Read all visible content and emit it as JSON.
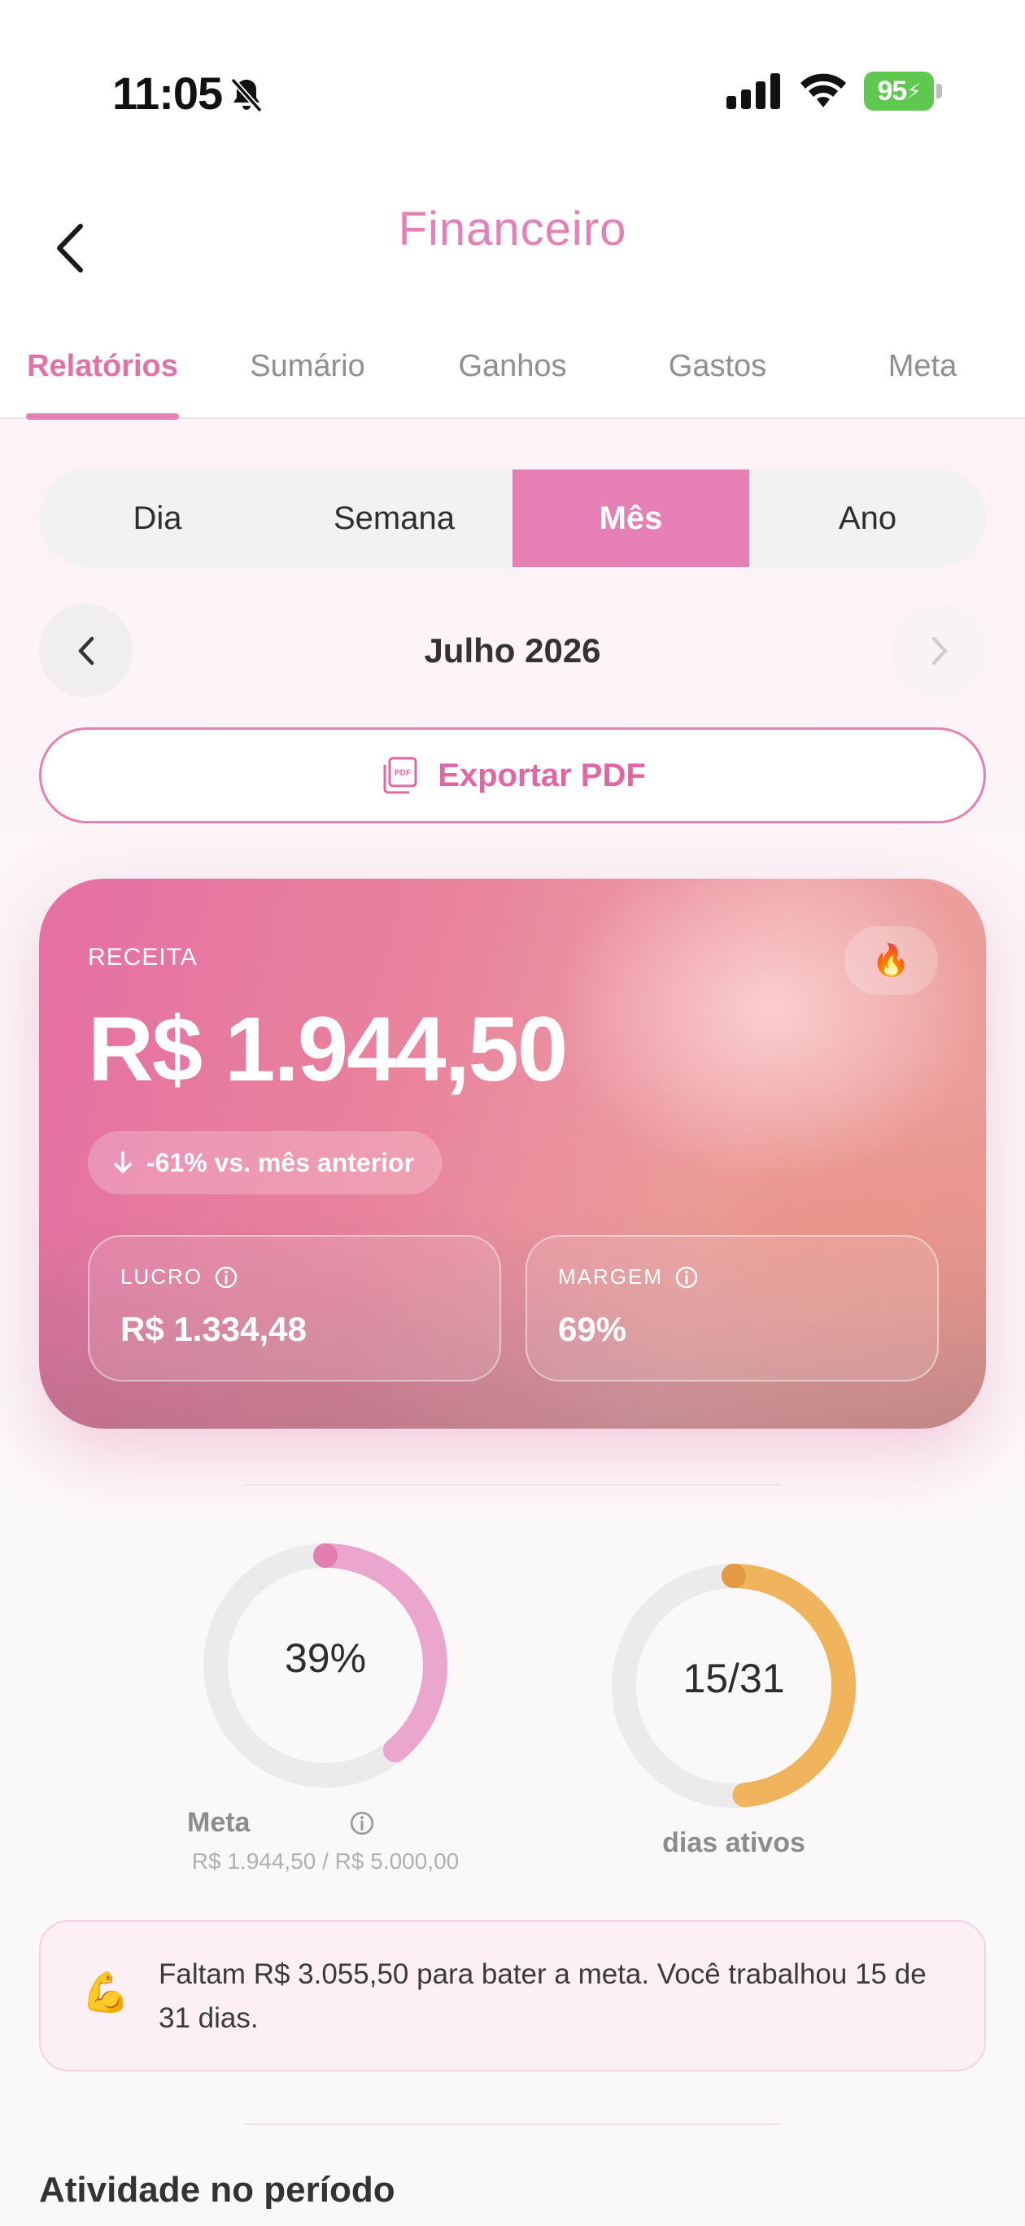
{
  "status": {
    "time": "11:05",
    "battery": "95"
  },
  "header": {
    "title": "Financeiro",
    "tabs": [
      {
        "label": "Relatórios",
        "active": true
      },
      {
        "label": "Sumário",
        "active": false
      },
      {
        "label": "Ganhos",
        "active": false
      },
      {
        "label": "Gastos",
        "active": false
      },
      {
        "label": "Meta",
        "active": false
      }
    ]
  },
  "period": {
    "options": [
      {
        "label": "Dia",
        "active": false
      },
      {
        "label": "Semana",
        "active": false
      },
      {
        "label": "Mês",
        "active": true
      },
      {
        "label": "Ano",
        "active": false
      }
    ],
    "current": "Julho 2026"
  },
  "export": {
    "label": "Exportar PDF"
  },
  "revenue": {
    "label": "RECEITA",
    "value": "R$ 1.944,50",
    "change": "-61% vs. mês anterior",
    "badge": "🔥",
    "profit": {
      "label": "LUCRO",
      "value": "R$ 1.334,48"
    },
    "margin": {
      "label": "MARGEM",
      "value": "69%"
    }
  },
  "goal": {
    "percent_text": "39%",
    "percent": 0.39,
    "caption": "Meta",
    "detail": "R$ 1.944,50 / R$ 5.000,00"
  },
  "days": {
    "text": "15/31",
    "fraction": 0.4839,
    "caption": "dias ativos"
  },
  "info": {
    "emoji": "💪",
    "text": "Faltam R$ 3.055,50 para bater a meta. Você trabalhou 15 de 31 dias."
  },
  "section": {
    "title": "Atividade no período"
  },
  "colors": {
    "brand": "#e67fb3",
    "ring_goal": "#eba6cd",
    "ring_days": "#f0b45c",
    "ring_track": "#ebebeb"
  }
}
